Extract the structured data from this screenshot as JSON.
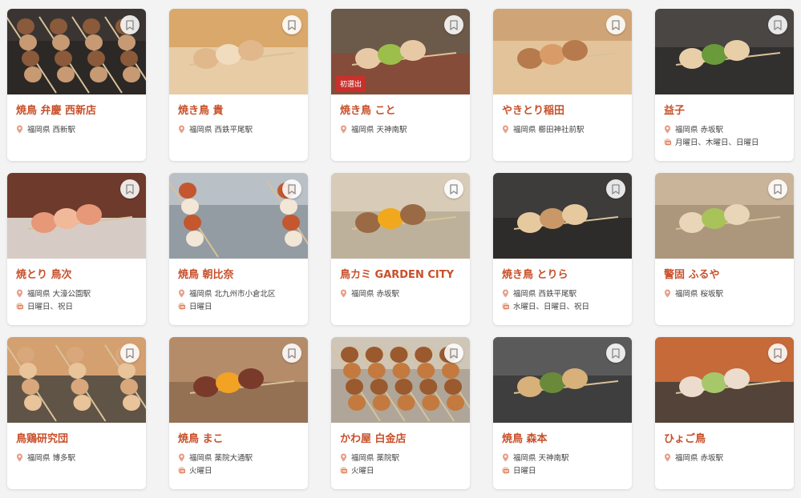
{
  "colors": {
    "accent": "#c8502a",
    "badge": "#c9302c",
    "pin": "#e8a08a"
  },
  "icons": {
    "bookmark": "bookmark-icon",
    "location": "location-pin-icon",
    "closed_days": "calendar-icon"
  },
  "shops": [
    {
      "name": "焼鳥 弁慶 西新店",
      "location": "福岡県 西新駅",
      "closed": "",
      "badge": ""
    },
    {
      "name": "焼き鳥 貴",
      "location": "福岡県 西鉄平尾駅",
      "closed": "",
      "badge": ""
    },
    {
      "name": "焼き鳥 こと",
      "location": "福岡県 天神南駅",
      "closed": "",
      "badge": "初選出"
    },
    {
      "name": "やきとり稲田",
      "location": "福岡県 櫛田神社前駅",
      "closed": "",
      "badge": ""
    },
    {
      "name": "益子",
      "location": "福岡県 赤坂駅",
      "closed": "月曜日、木曜日、日曜日",
      "badge": ""
    },
    {
      "name": "焼とり 鳥次",
      "location": "福岡県 大濠公園駅",
      "closed": "日曜日、祝日",
      "badge": ""
    },
    {
      "name": "焼鳥 朝比奈",
      "location": "福岡県 北九州市小倉北区",
      "closed": "日曜日",
      "badge": ""
    },
    {
      "name": "鳥カミ GARDEN CITY",
      "location": "福岡県 赤坂駅",
      "closed": "",
      "badge": ""
    },
    {
      "name": "焼き鳥 とりら",
      "location": "福岡県 西鉄平尾駅",
      "closed": "水曜日、日曜日、祝日",
      "badge": ""
    },
    {
      "name": "警固 ふるや",
      "location": "福岡県 桜坂駅",
      "closed": "",
      "badge": ""
    },
    {
      "name": "鳥鶏研究団",
      "location": "福岡県 博多駅",
      "closed": "",
      "badge": ""
    },
    {
      "name": "焼鳥 まこ",
      "location": "福岡県 薬院大通駅",
      "closed": "火曜日",
      "badge": ""
    },
    {
      "name": "かわ屋 白金店",
      "location": "福岡県 薬院駅",
      "closed": "火曜日",
      "badge": ""
    },
    {
      "name": "焼鳥 森本",
      "location": "福岡県 天神南駅",
      "closed": "日曜日",
      "badge": ""
    },
    {
      "name": "ひょご鳥",
      "location": "福岡県 赤坂駅",
      "closed": "",
      "badge": ""
    }
  ]
}
